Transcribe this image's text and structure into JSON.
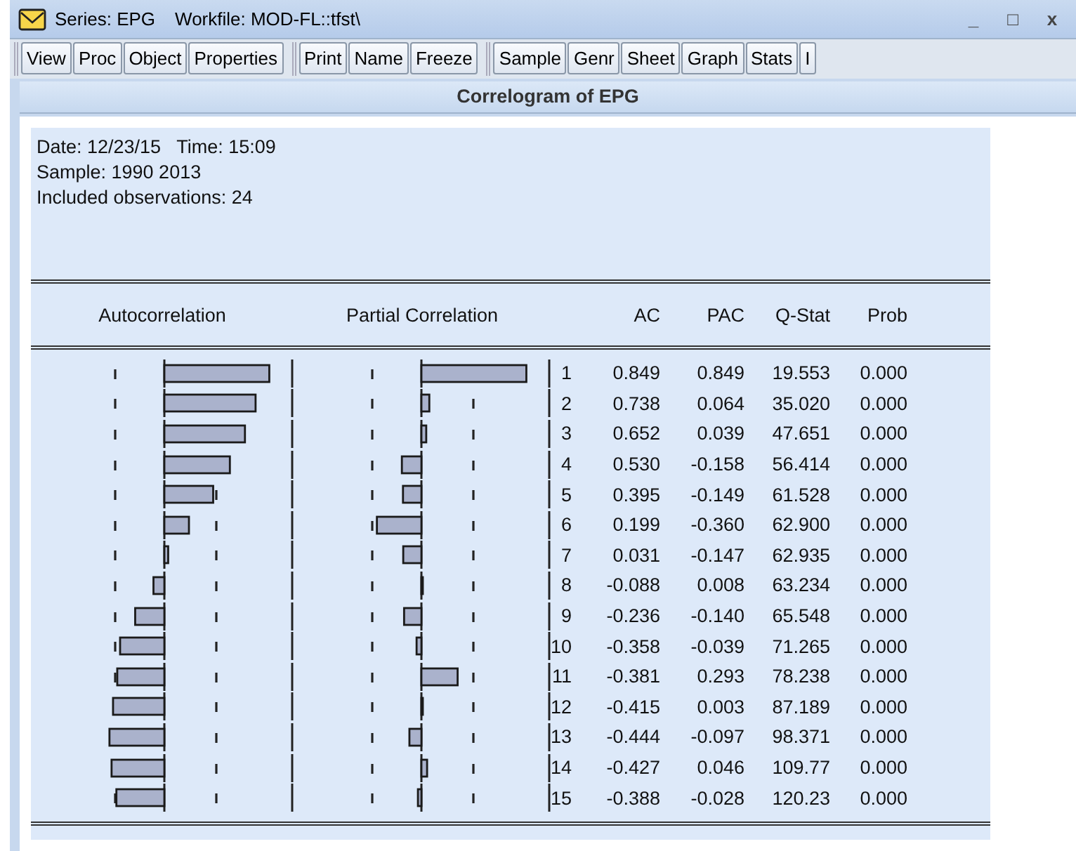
{
  "window": {
    "title_series": "Series: EPG",
    "title_workfile": "Workfile: MOD-FL::tfst\\",
    "controls": [
      "_",
      "□",
      "x"
    ]
  },
  "toolbar": [
    [
      "View",
      "Proc",
      "Object",
      "Properties"
    ],
    [
      "Print",
      "Name",
      "Freeze"
    ],
    [
      "Sample",
      "Genr",
      "Sheet",
      "Graph",
      "Stats",
      "I"
    ]
  ],
  "view_title": "Correlogram of EPG",
  "info": [
    "Date: 12/23/15   Time: 15:09",
    "Sample: 1990 2013",
    "Included observations: 24"
  ],
  "columns": [
    "Autocorrelation",
    "Partial Correlation",
    "AC",
    "PAC",
    "Q-Stat",
    "Prob"
  ],
  "rows": [
    {
      "lag": "1",
      "ac": "0.849",
      "pac": "0.849",
      "q_stat": "19.553",
      "prob": "0.000"
    },
    {
      "lag": "2",
      "ac": "0.738",
      "pac": "0.064",
      "q_stat": "35.020",
      "prob": "0.000"
    },
    {
      "lag": "3",
      "ac": "0.652",
      "pac": "0.039",
      "q_stat": "47.651",
      "prob": "0.000"
    },
    {
      "lag": "4",
      "ac": "0.530",
      "pac": "-0.158",
      "q_stat": "56.414",
      "prob": "0.000"
    },
    {
      "lag": "5",
      "ac": "0.395",
      "pac": "-0.149",
      "q_stat": "61.528",
      "prob": "0.000"
    },
    {
      "lag": "6",
      "ac": "0.199",
      "pac": "-0.360",
      "q_stat": "62.900",
      "prob": "0.000"
    },
    {
      "lag": "7",
      "ac": "0.031",
      "pac": "-0.147",
      "q_stat": "62.935",
      "prob": "0.000"
    },
    {
      "lag": "8",
      "ac": "-0.088",
      "pac": "0.008",
      "q_stat": "63.234",
      "prob": "0.000"
    },
    {
      "lag": "9",
      "ac": "-0.236",
      "pac": "-0.140",
      "q_stat": "65.548",
      "prob": "0.000"
    },
    {
      "lag": "10",
      "ac": "-0.358",
      "pac": "-0.039",
      "q_stat": "71.265",
      "prob": "0.000"
    },
    {
      "lag": "11",
      "ac": "-0.381",
      "pac": "0.293",
      "q_stat": "78.238",
      "prob": "0.000"
    },
    {
      "lag": "12",
      "ac": "-0.415",
      "pac": "0.003",
      "q_stat": "87.189",
      "prob": "0.000"
    },
    {
      "lag": "13",
      "ac": "-0.444",
      "pac": "-0.097",
      "q_stat": "98.371",
      "prob": "0.000"
    },
    {
      "lag": "14",
      "ac": "-0.427",
      "pac": "0.046",
      "q_stat": "109.77",
      "prob": "0.000"
    },
    {
      "lag": "15",
      "ac": "-0.388",
      "pac": "-0.028",
      "q_stat": "120.23",
      "prob": "0.000"
    }
  ]
}
